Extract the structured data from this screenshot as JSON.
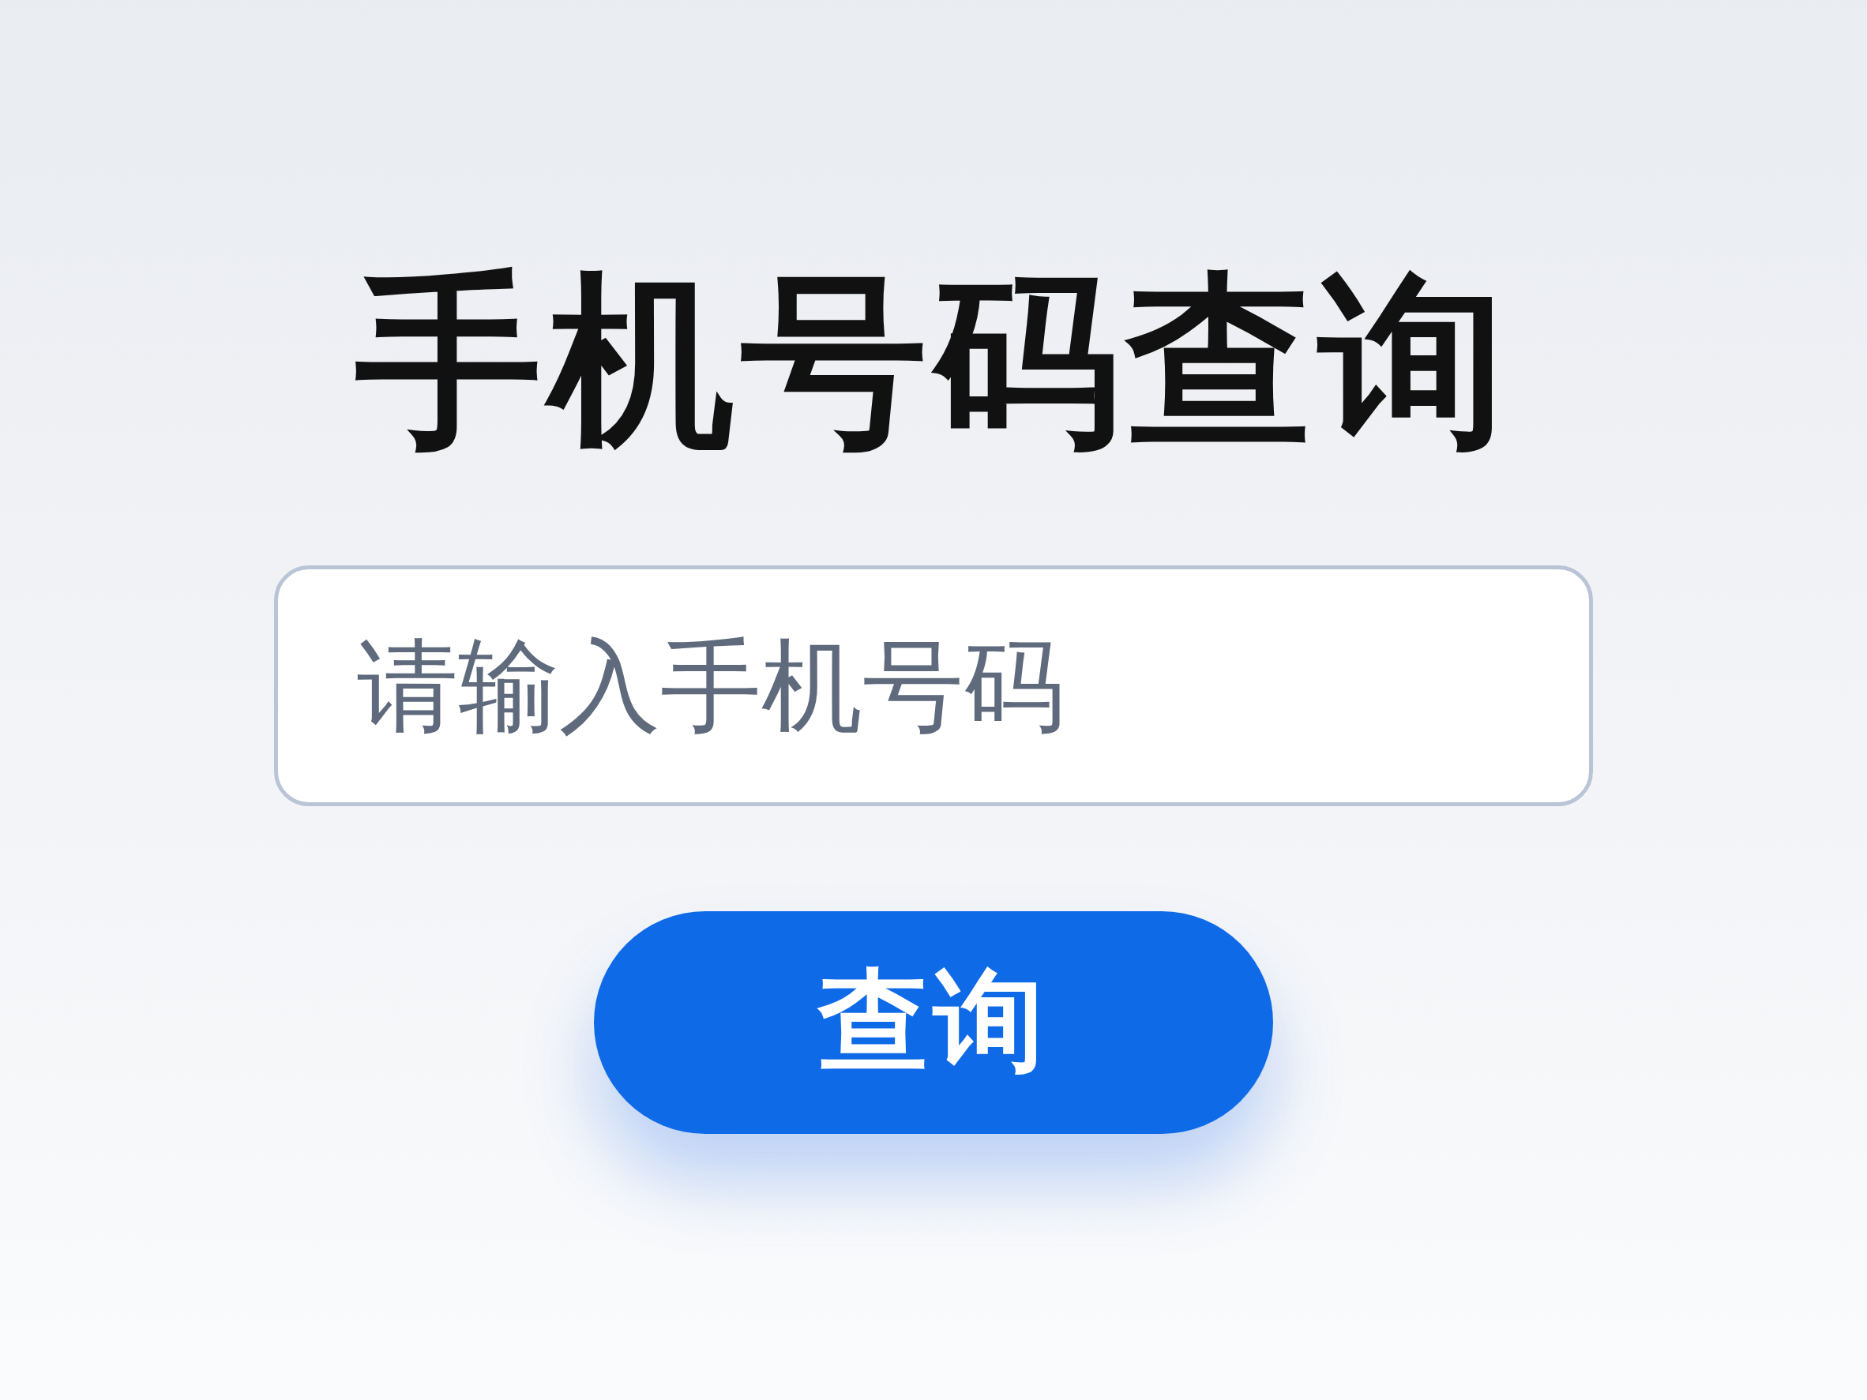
{
  "title": "手机号码查询",
  "phone_field": {
    "placeholder": "请输入手机号码"
  },
  "query_button": {
    "label": "查询"
  }
}
